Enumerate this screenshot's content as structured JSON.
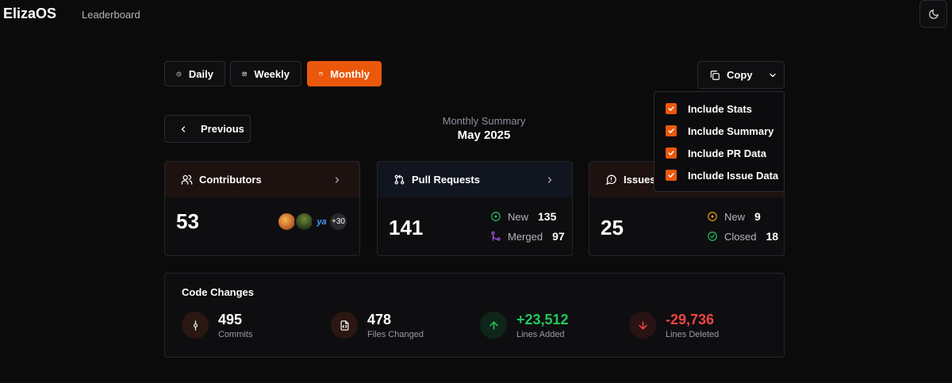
{
  "header": {
    "brand": "ElizaOS",
    "nav_leaderboard": "Leaderboard"
  },
  "periods": [
    {
      "label": "Daily",
      "icon": "clock-icon",
      "active": false
    },
    {
      "label": "Weekly",
      "icon": "calendar-icon",
      "active": false
    },
    {
      "label": "Monthly",
      "icon": "calendar-icon",
      "active": true
    }
  ],
  "copy": {
    "label": "Copy",
    "options": [
      {
        "label": "Include Stats",
        "checked": true
      },
      {
        "label": "Include Summary",
        "checked": true
      },
      {
        "label": "Include PR Data",
        "checked": true
      },
      {
        "label": "Include Issue Data",
        "checked": true
      }
    ]
  },
  "navigation": {
    "previous_label": "Previous"
  },
  "summary": {
    "label": "Monthly Summary",
    "period": "May 2025"
  },
  "contributors": {
    "title": "Contributors",
    "count": "53",
    "more_badge": "+30"
  },
  "pull_requests": {
    "title": "Pull Requests",
    "count": "141",
    "new_label": "New",
    "new_count": "135",
    "merged_label": "Merged",
    "merged_count": "97"
  },
  "issues": {
    "title": "Issues",
    "count": "25",
    "new_label": "New",
    "new_count": "9",
    "closed_label": "Closed",
    "closed_count": "18"
  },
  "code_changes": {
    "title": "Code Changes",
    "commits": {
      "value": "495",
      "label": "Commits"
    },
    "files": {
      "value": "478",
      "label": "Files Changed"
    },
    "added": {
      "value": "+23,512",
      "label": "Lines Added"
    },
    "deleted": {
      "value": "-29,736",
      "label": "Lines Deleted"
    }
  },
  "colors": {
    "accent": "#ea580c",
    "green": "#22c55e",
    "red": "#ef4444",
    "purple": "#a855f7"
  }
}
